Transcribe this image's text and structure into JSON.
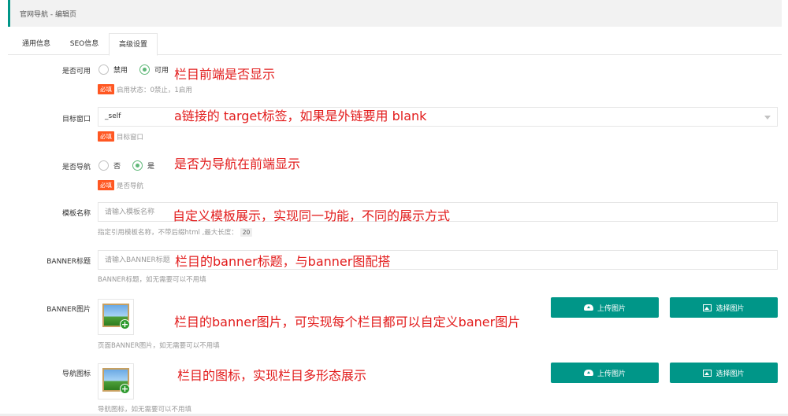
{
  "header": {
    "title": "官网导航 - 编辑页"
  },
  "tabs": [
    {
      "label": "通用信息"
    },
    {
      "label": "SEO信息"
    },
    {
      "label": "高级设置"
    }
  ],
  "form": {
    "enabled": {
      "label": "是否可用",
      "options": [
        "禁用",
        "可用"
      ],
      "selected": "可用",
      "required_badge": "必填",
      "help": "启用状态：0禁止，1启用",
      "annotation": "栏目前端是否显示"
    },
    "target": {
      "label": "目标窗口",
      "value": "_self",
      "required_badge": "必填",
      "help": "目标窗口",
      "annotation": "a链接的 target标签，如果是外链要用 blank"
    },
    "is_nav": {
      "label": "是否导航",
      "options": [
        "否",
        "是"
      ],
      "selected": "是",
      "required_badge": "必填",
      "help": "是否导航",
      "annotation": "是否为导航在前端显示"
    },
    "template": {
      "label": "模板名称",
      "placeholder": "请输入模板名称",
      "help": "指定引用模板名称，不带后缀html ,最大长度：",
      "max_length": "20",
      "annotation": "自定义模板展示，实现同一功能，不同的展示方式"
    },
    "banner_title": {
      "label": "BANNER标题",
      "placeholder": "请输入BANNER标题",
      "help": "BANNER标题，如无需要可以不用填",
      "annotation": "栏目的banner标题，与banner图配搭"
    },
    "banner_image": {
      "label": "BANNER图片",
      "upload_label": "上传图片",
      "choose_label": "选择图片",
      "help": "页面BANNER图片，如无需要可以不用填",
      "annotation": "栏目的banner图片，可实现每个栏目都可以自定义baner图片"
    },
    "nav_icon": {
      "label": "导航图标",
      "upload_label": "上传图片",
      "choose_label": "选择图片",
      "help": "导航图标，如无需要可以不用填",
      "annotation": "栏目的图标，实现栏目多形态展示"
    }
  },
  "colors": {
    "accent": "#009688",
    "required": "#ff5722",
    "radio_on": "#5fb878",
    "annotation": "#e21b1b"
  },
  "icons": {
    "upload": "cloud-upload-icon",
    "choose": "image-icon"
  }
}
